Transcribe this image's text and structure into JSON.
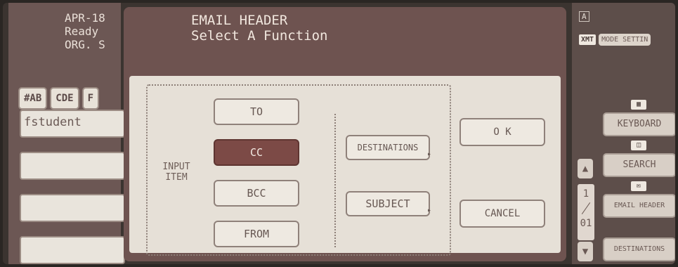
{
  "status": {
    "date": "APR-18",
    "state": "Ready",
    "org": "ORG. S"
  },
  "tabs": [
    "#AB",
    "CDE",
    "F"
  ],
  "entries": [
    "fstudent",
    "",
    "",
    ""
  ],
  "dialog": {
    "title": "EMAIL HEADER",
    "subtitle": "Select A Function",
    "input_item_label": "INPUT ITEM",
    "items": [
      {
        "label": "TO",
        "selected": false
      },
      {
        "label": "CC",
        "selected": true
      },
      {
        "label": "BCC",
        "selected": false
      },
      {
        "label": "FROM",
        "selected": false
      }
    ],
    "destinations_label": "DESTINATIONS",
    "subject_label": "SUBJECT",
    "ok_label": "O K",
    "cancel_label": "CANCEL"
  },
  "right_panel": {
    "top_label": "A",
    "xmt_label": "XMT",
    "mode_setting_label": "MODE SETTIN",
    "keyboard_label": "KEYBOARD",
    "search_label": "SEARCH",
    "email_header_label": "EMAIL HEADER",
    "destinations_label": "DESTINATIONS",
    "page_current": "1",
    "page_total": "01"
  }
}
